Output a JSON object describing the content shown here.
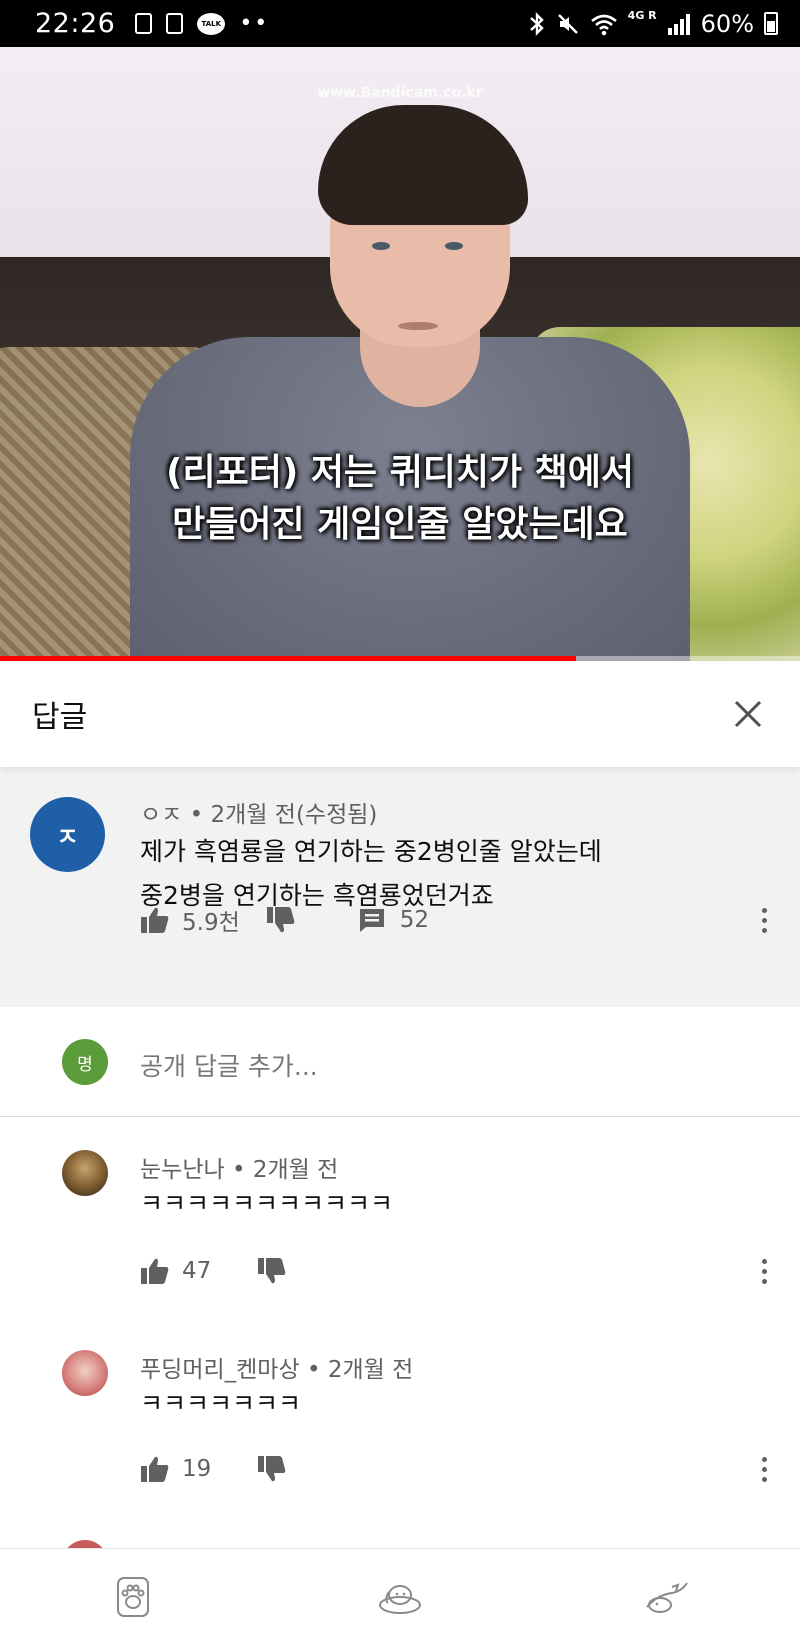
{
  "status_bar": {
    "time": "22:26",
    "talk_badge": "TALK",
    "more_dots": "••",
    "network": "4G R",
    "battery": "60%"
  },
  "video": {
    "watermark": "www.Bandicam.co.kr",
    "subtitle_line1": "(리포터) 저는 퀴디치가 책에서",
    "subtitle_line2": "만들어진 게임인줄 알았는데요",
    "progress": 0.72,
    "progress_color": "#ff0000"
  },
  "replies_panel": {
    "title": "답글"
  },
  "parent_comment": {
    "avatar_letter": "ㅈ",
    "avatar_color": "#1f5fa8",
    "author": "ㅇㅈ",
    "time": "2개월 전(수정됨)",
    "text_line1": "제가 흑염룡을 연기하는 중2병인줄 알았는데",
    "text_line2": "중2병을 연기하는 흑염룡었던거죠",
    "likes": "5.9천",
    "reply_count": "52"
  },
  "add_reply": {
    "avatar_letter": "명",
    "avatar_color": "#5c9b3a",
    "placeholder": "공개 답글 추가..."
  },
  "replies": [
    {
      "author": "눈누난나",
      "time": "2개월 전",
      "text": "ㅋㅋㅋㅋㅋㅋㅋㅋㅋㅋㅋ",
      "likes": "47"
    },
    {
      "author": "푸딩머리_켄마상",
      "time": "2개월 전",
      "text": "ㅋㅋㅋㅋㅋㅋㅋ",
      "likes": "19"
    }
  ],
  "bottom_nav": {
    "items": [
      "paw-icon",
      "puppy-icon",
      "sleeping-dog-icon"
    ]
  }
}
